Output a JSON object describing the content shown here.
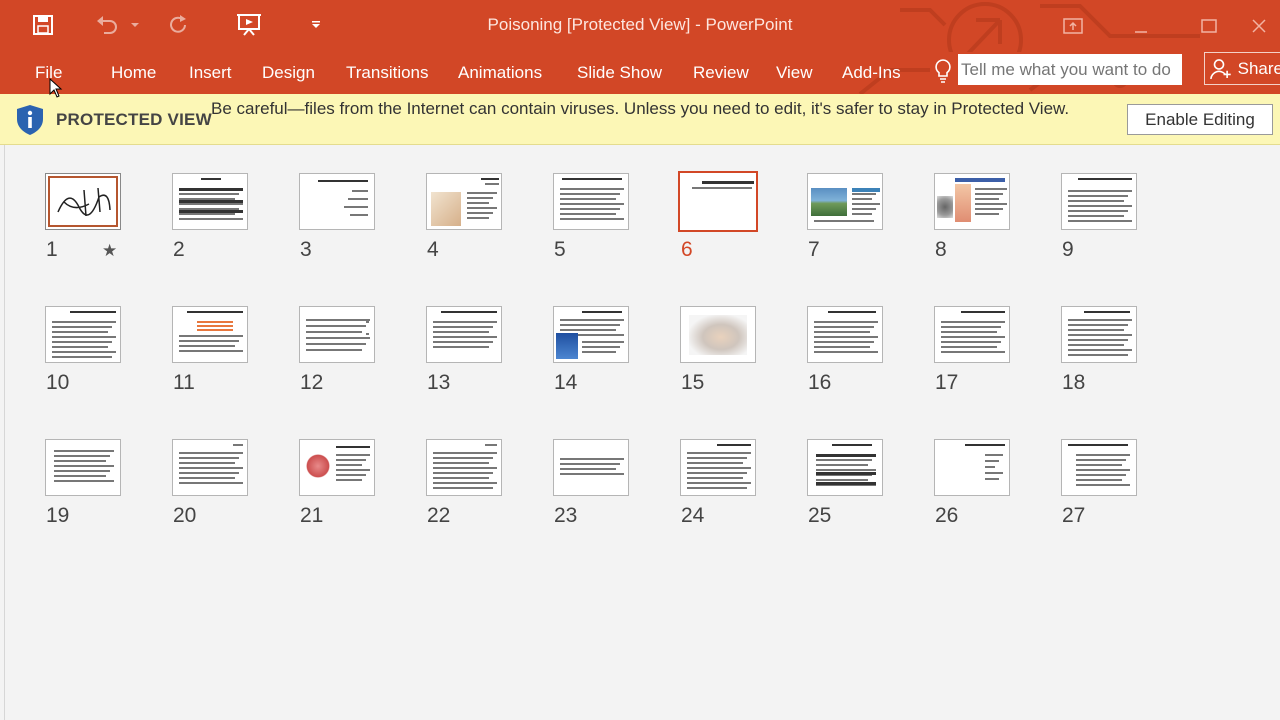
{
  "window": {
    "title": "Poisoning [Protected View] - PowerPoint"
  },
  "quick_access": [
    {
      "name": "save-icon"
    },
    {
      "name": "undo-icon"
    },
    {
      "name": "redo-icon"
    },
    {
      "name": "start-from-beginning-icon"
    },
    {
      "name": "customize-qat-icon"
    }
  ],
  "ribbon": {
    "tabs": [
      "File",
      "Home",
      "Insert",
      "Design",
      "Transitions",
      "Animations",
      "Slide Show",
      "Review",
      "View",
      "Add-Ins"
    ],
    "tell_me_placeholder": "Tell me what you want to do",
    "share_label": "Share"
  },
  "protected_view": {
    "label": "PROTECTED VIEW",
    "message": "Be careful—files from the Internet can contain viruses. Unless you need to edit, it's safer to stay in Protected View.",
    "enable_button": "Enable Editing"
  },
  "slides": {
    "selected": 6,
    "starred": 1,
    "numbers": [
      "1",
      "2",
      "3",
      "4",
      "5",
      "6",
      "7",
      "8",
      "9",
      "10",
      "11",
      "12",
      "13",
      "14",
      "15",
      "16",
      "17",
      "18",
      "19",
      "20",
      "21",
      "22",
      "23",
      "24",
      "25",
      "26",
      "27"
    ]
  },
  "colors": {
    "accent": "#d24726",
    "protected_bar": "#fcf7b6",
    "background": "#f3f3f3"
  }
}
